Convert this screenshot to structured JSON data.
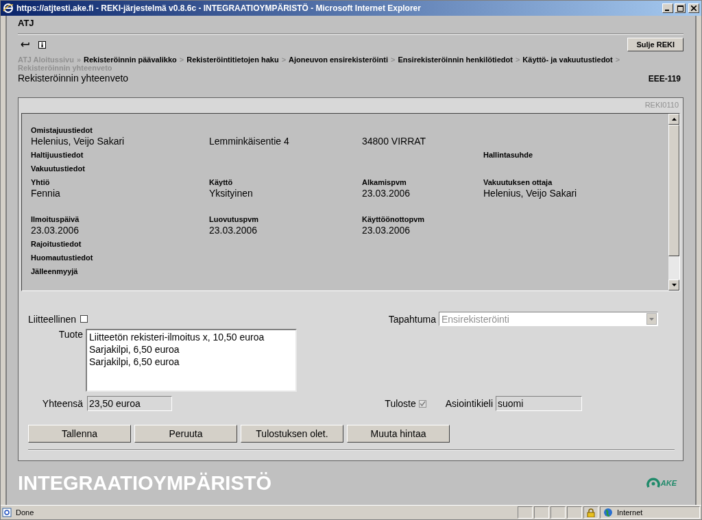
{
  "window": {
    "title": "https://atjtesti.ake.fi - REKI-järjestelmä v0.8.6c - INTEGRAATIOYMPÄRISTÖ - Microsoft Internet Explorer"
  },
  "app_label": "ATJ",
  "close_button": "Sulje REKI",
  "breadcrumb": [
    {
      "label": "ATJ Aloitussivu",
      "dimmed": true,
      "separator": "»"
    },
    {
      "label": "Rekisteröinnin päävalikko",
      "dimmed": false,
      "separator": ">"
    },
    {
      "label": "Rekisteröintitietojen haku",
      "dimmed": false,
      "separator": ">"
    },
    {
      "label": "Ajoneuvon ensirekisteröinti",
      "dimmed": false,
      "separator": ">"
    },
    {
      "label": "Ensirekisteröinnin henkilötiedot",
      "dimmed": false,
      "separator": ">"
    },
    {
      "label": "Käyttö- ja vakuutustiedot",
      "dimmed": false,
      "separator": ">"
    },
    {
      "label": "Rekisteröinnin yhteenveto",
      "dimmed": true
    }
  ],
  "page_title": "Rekisteröinnin yhteenveto",
  "plate": "EEE-119",
  "form_code": "REKI0110",
  "summary": [
    {
      "kind": "heading",
      "cells": {
        "column_1": "Omistajuustiedot"
      }
    },
    {
      "kind": "value",
      "cells": {
        "column_1": "Helenius, Veijo Sakari",
        "column_2": "Lemminkäisentie 4",
        "column_3": "34800 VIRRAT"
      }
    },
    {
      "kind": "heading",
      "cells": {
        "column_1": "Haltijuustiedot",
        "column_4": "Hallintasuhde"
      }
    },
    {
      "kind": "heading",
      "cells": {
        "column_1": "Vakuutustiedot"
      }
    },
    {
      "kind": "heading",
      "cells": {
        "column_1": "Yhtiö",
        "column_2": "Käyttö",
        "column_3": "Alkamispvm",
        "column_4": "Vakuutuksen ottaja"
      }
    },
    {
      "kind": "value",
      "cells": {
        "column_1": "Fennia",
        "column_2": "Yksityinen",
        "column_3": "23.03.2006",
        "column_4": "Helenius, Veijo Sakari"
      }
    },
    {
      "kind": "heading",
      "cells": {
        "column_1": "Ilmoituspäivä",
        "column_2": "Luovutuspvm",
        "column_3": "Käyttöönottopvm"
      }
    },
    {
      "kind": "value",
      "cells": {
        "column_1": "23.03.2006",
        "column_2": "23.03.2006",
        "column_3": "23.03.2006"
      }
    },
    {
      "kind": "heading",
      "cells": {
        "column_1": "Rajoitustiedot"
      }
    },
    {
      "kind": "heading",
      "cells": {
        "column_1": "Huomautustiedot"
      }
    },
    {
      "kind": "heading",
      "cells": {
        "column_1": "Jälleenmyyjä"
      }
    }
  ],
  "attachment": {
    "label": "Liitteellinen",
    "checked": false
  },
  "event": {
    "label": "Tapahtuma",
    "value": "Ensirekisteröinti",
    "disabled": true
  },
  "products": {
    "label": "Tuote",
    "items": [
      "Liitteetön rekisteri-ilmoitus x, 10,50 euroa",
      "Sarjakilpi, 6,50 euroa",
      "Sarjakilpi, 6,50 euroa"
    ]
  },
  "total": {
    "label": "Yhteensä",
    "value": "23,50 euroa"
  },
  "printout": {
    "label": "Tuloste",
    "checked": true,
    "disabled": true
  },
  "language": {
    "label": "Asiointikieli",
    "value": "suomi"
  },
  "buttons": [
    "Tallenna",
    "Peruuta",
    "Tulostuksen olet.",
    "Muuta hintaa"
  ],
  "environment": "INTEGRAATIOYMPÄRISTÖ",
  "logo_text": "AKE",
  "status_bar": {
    "text": "Done",
    "zone": "Internet"
  }
}
